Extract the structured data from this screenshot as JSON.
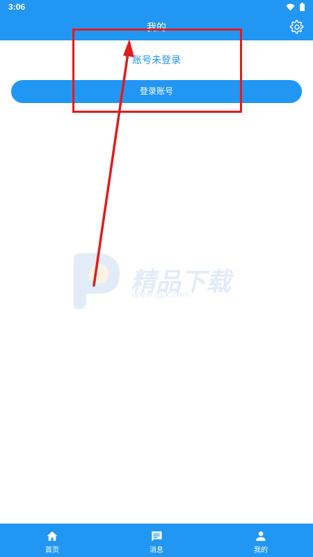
{
  "status_bar": {
    "time": "3:06",
    "icons": [
      "wifi-icon",
      "battery-icon"
    ]
  },
  "app_bar": {
    "title": "我的",
    "settings_icon": "gear-icon"
  },
  "profile": {
    "login_status": "账号未登录",
    "login_button_label": "登录账号"
  },
  "watermark": {
    "title": "精品下载",
    "url": "www.jpjx.com"
  },
  "bottom_nav": {
    "items": [
      {
        "label": "首页",
        "icon": "home-icon"
      },
      {
        "label": "消息",
        "icon": "message-icon"
      },
      {
        "label": "我的",
        "icon": "person-icon"
      }
    ]
  },
  "colors": {
    "primary": "#2196f3",
    "annotation": "#e01c1c"
  }
}
